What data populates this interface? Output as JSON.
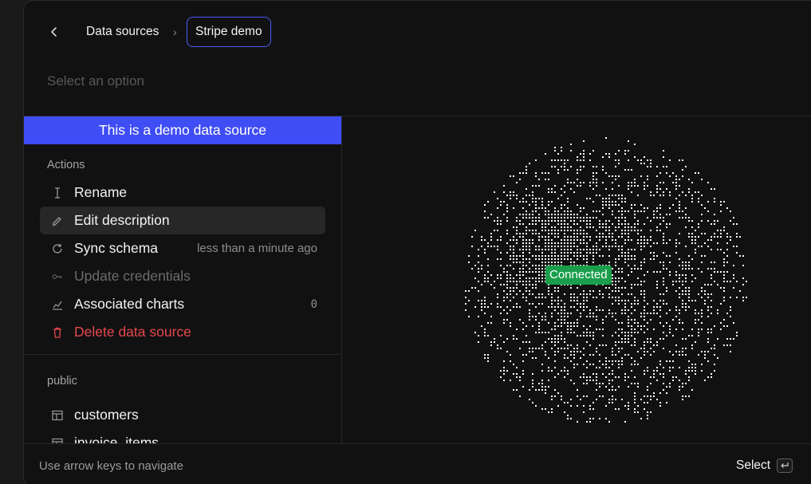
{
  "breadcrumb": {
    "items": [
      "Data sources",
      "Stripe demo"
    ],
    "separator": "›"
  },
  "search": {
    "placeholder": "Select an option",
    "value": ""
  },
  "banner": {
    "text": "This is a demo data source",
    "color": "#3f4df5"
  },
  "actions": {
    "heading": "Actions",
    "items": [
      {
        "label": "Rename",
        "icon": "text-cursor-icon"
      },
      {
        "label": "Edit description",
        "icon": "pencil-icon",
        "active": true
      },
      {
        "label": "Sync schema",
        "icon": "refresh-icon",
        "meta": "less than a minute ago"
      },
      {
        "label": "Update credentials",
        "icon": "key-icon",
        "disabled": true
      },
      {
        "label": "Associated charts",
        "icon": "chart-icon",
        "meta": "0"
      },
      {
        "label": "Delete data source",
        "icon": "trash-icon",
        "danger": true
      }
    ]
  },
  "schema": {
    "heading": "public",
    "tables": [
      {
        "label": "customers",
        "icon": "table-icon"
      },
      {
        "label": "invoice_items",
        "icon": "table-icon"
      }
    ]
  },
  "preview": {
    "status": "Connected",
    "status_color": "#1a9e4c"
  },
  "footer": {
    "hint": "Use arrow keys to navigate",
    "select_label": "Select",
    "select_icon": "enter-key-icon"
  },
  "colors": {
    "accent": "#3f4df5",
    "danger": "#e5484d",
    "success": "#1a9e4c"
  }
}
